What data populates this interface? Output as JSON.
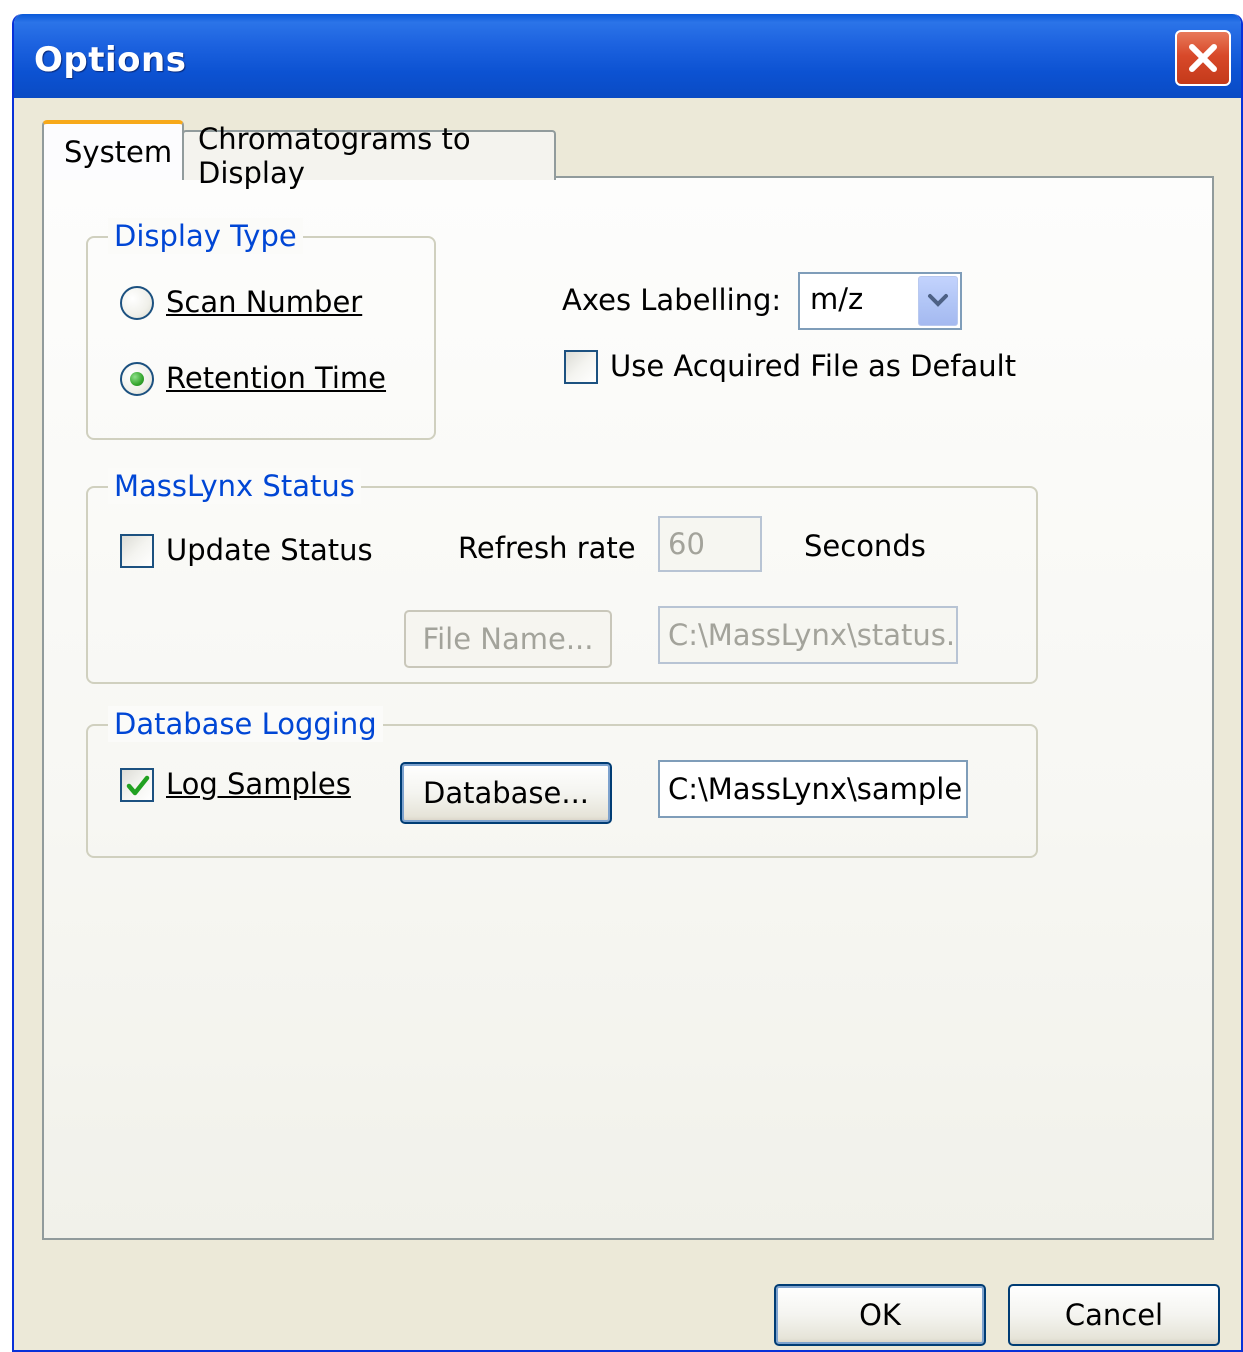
{
  "window": {
    "title": "Options"
  },
  "tabs": [
    {
      "label": "System",
      "selected": true
    },
    {
      "label": "Chromatograms to Display",
      "selected": false
    }
  ],
  "display_type": {
    "group_title": "Display Type",
    "options": [
      {
        "label": "Scan Number",
        "selected": false
      },
      {
        "label": "Retention Time",
        "selected": true
      }
    ]
  },
  "axes": {
    "label": "Axes Labelling:",
    "value": "m/z",
    "use_acquired_label": "Use Acquired File as Default",
    "use_acquired_checked": false
  },
  "status": {
    "group_title": "MassLynx Status",
    "update_label": "Update Status",
    "update_checked": false,
    "refresh_label": "Refresh rate",
    "refresh_value": "60",
    "seconds_label": "Seconds",
    "file_button": "File Name...",
    "file_path": "C:\\MassLynx\\status."
  },
  "logging": {
    "group_title": "Database Logging",
    "log_label": "Log Samples",
    "log_checked": true,
    "database_button": "Database...",
    "database_path": "C:\\MassLynx\\sample"
  },
  "buttons": {
    "ok": "OK",
    "cancel": "Cancel"
  },
  "colors": {
    "titlebar": "#0a5ad9",
    "group_title": "#0046d5",
    "tab_highlight": "#f7a91a",
    "radio_dot": "#35a62e",
    "check_mark": "#21a121",
    "close_button": "#d8492a"
  },
  "icons": {
    "close": "close-icon",
    "combo_arrow": "chevron-down-icon",
    "check": "check-icon"
  }
}
